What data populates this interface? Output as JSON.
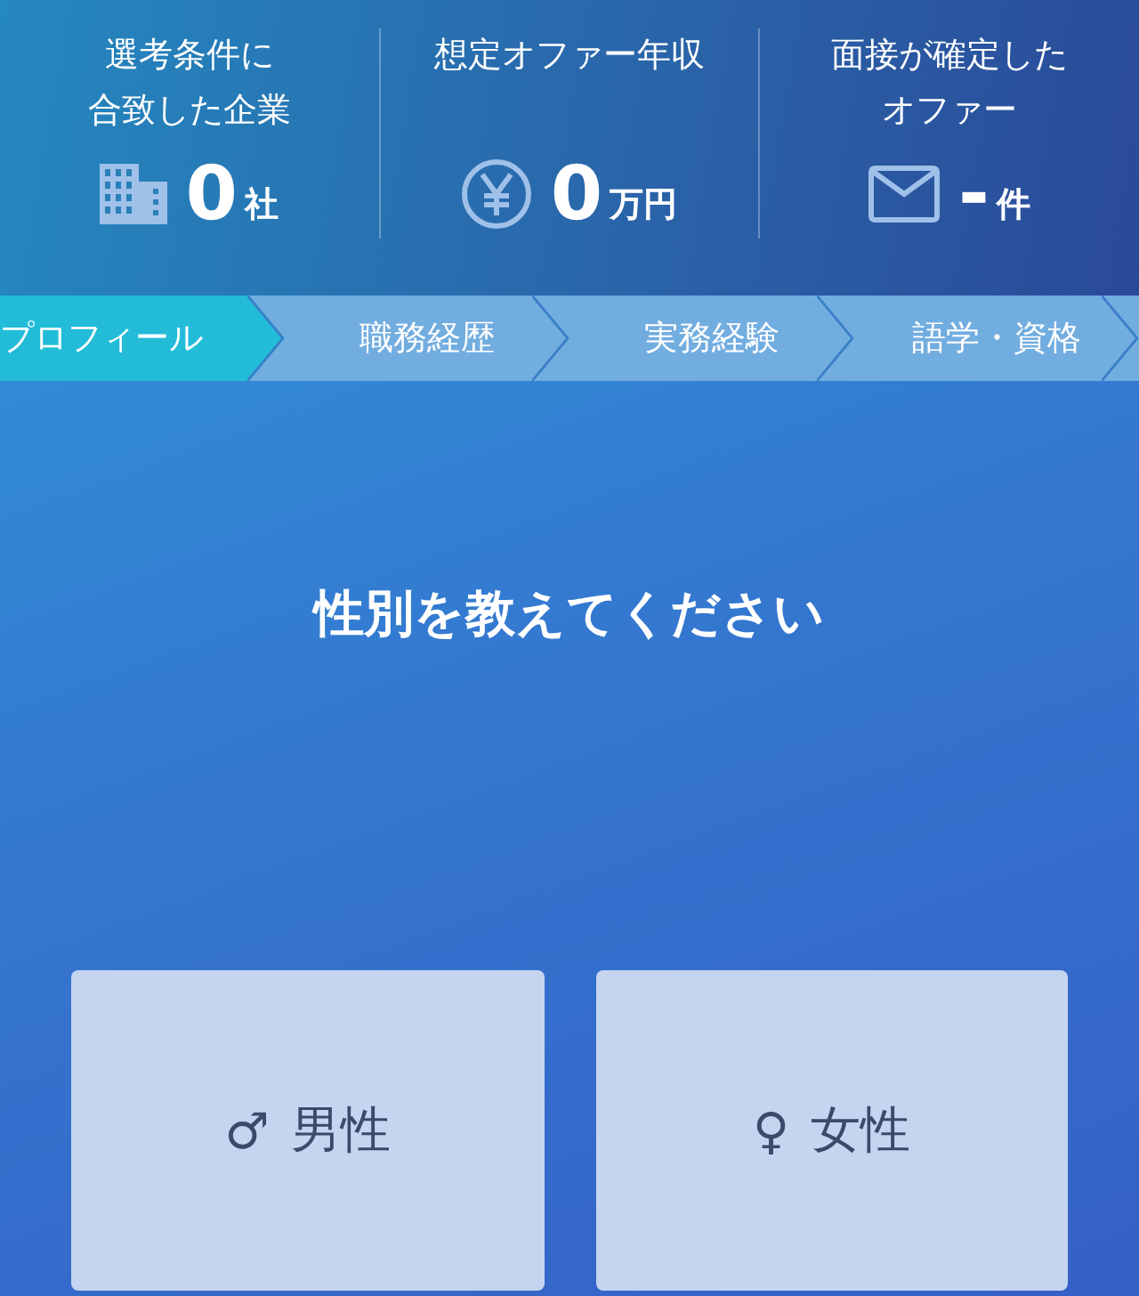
{
  "stats": [
    {
      "kind": "building",
      "label_lines": [
        "選考条件に",
        "合致した企業"
      ],
      "value": "0",
      "unit": "社"
    },
    {
      "kind": "yen",
      "label_lines": [
        "想定オファー年収"
      ],
      "value": "0",
      "unit": "万円"
    },
    {
      "kind": "mail",
      "label_lines": [
        "面接が確定した",
        "オファー"
      ],
      "value": "-",
      "unit": "件"
    }
  ],
  "steps": [
    {
      "label": "プロフィール",
      "selected": true
    },
    {
      "label": "職務経歴",
      "selected": false
    },
    {
      "label": "実務経験",
      "selected": false
    },
    {
      "label": "語学・資格",
      "selected": false
    }
  ],
  "question": "性別を教えてください",
  "options": [
    {
      "symbol": "♂",
      "label": "男性",
      "selected": false
    },
    {
      "symbol": "♀",
      "label": "女性",
      "selected": false
    }
  ]
}
